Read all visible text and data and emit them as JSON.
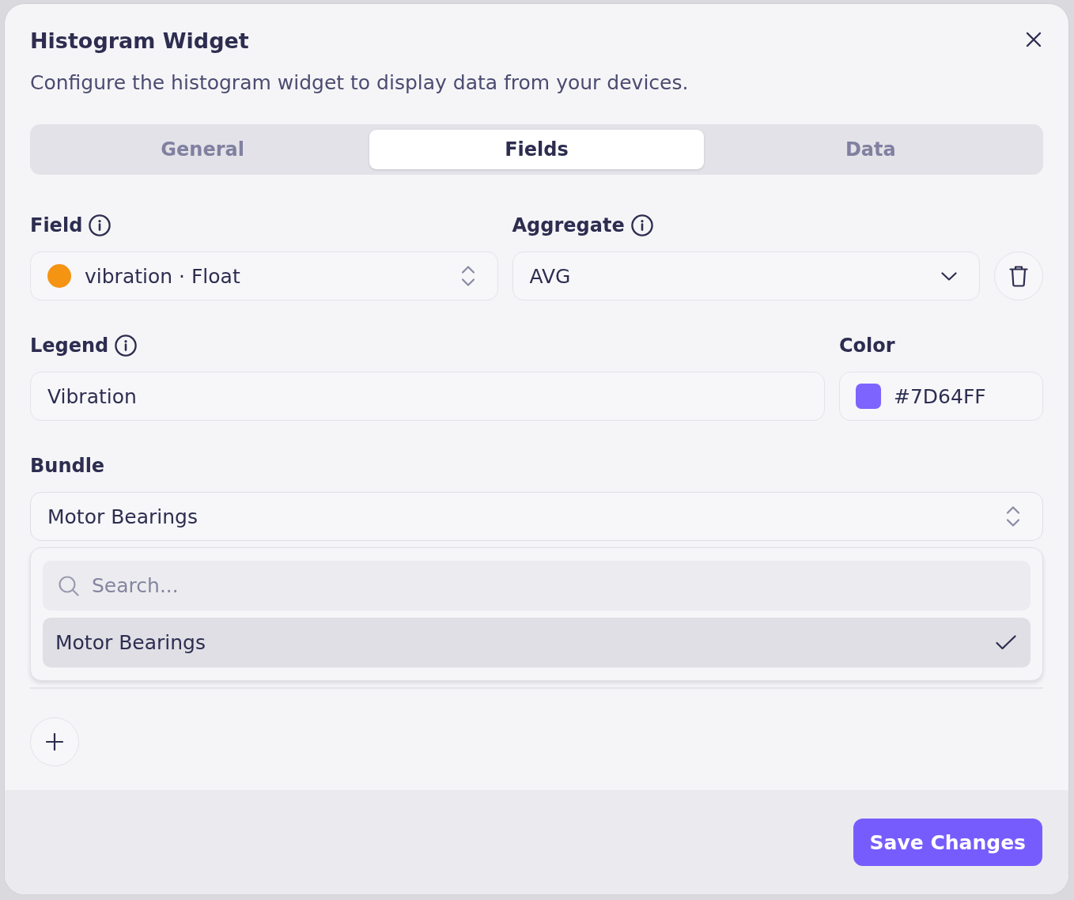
{
  "dialog": {
    "title": "Histogram Widget",
    "description": "Configure the histogram widget to display data from your devices."
  },
  "tabs": [
    {
      "label": "General",
      "selected": false
    },
    {
      "label": "Fields",
      "selected": true
    },
    {
      "label": "Data",
      "selected": false
    }
  ],
  "series": {
    "field": {
      "label": "Field",
      "info": true,
      "kind": "combobox",
      "value": "vibration · Float",
      "color": "#f59312"
    },
    "aggregate": {
      "label": "Aggregate",
      "info": true,
      "kind": "select",
      "value": "AVG"
    },
    "legend": {
      "label": "Legend",
      "info": true,
      "kind": "text",
      "value": "Vibration"
    },
    "color": {
      "label": "Color",
      "info": false,
      "kind": "color",
      "value": "#7D64FF",
      "color": "#7d64ff"
    },
    "bundle": {
      "label": "Bundle",
      "info": false,
      "kind": "combobox",
      "value": "Motor Bearings",
      "expanded": true,
      "search": {
        "placeholder": "Search..."
      },
      "options": [
        {
          "label": "Motor Bearings",
          "selected": true
        }
      ]
    }
  },
  "footer": {
    "buttons": [
      {
        "label": "Save Changes"
      }
    ]
  }
}
